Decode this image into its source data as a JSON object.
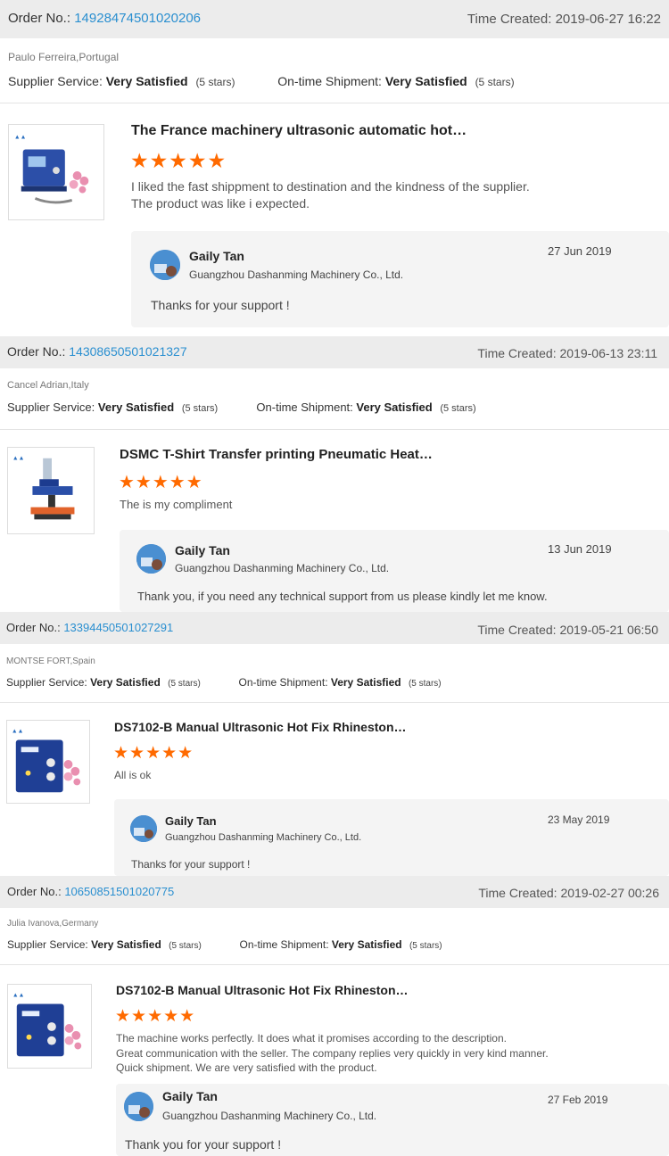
{
  "labels": {
    "order_no": "Order No.:",
    "time_created": "Time Created:",
    "supplier_service": "Supplier Service:",
    "ontime_shipment": "On-time Shipment:",
    "very_satisfied": "Very Satisfied",
    "five_stars": "(5 stars)",
    "stars_glyphs": "★★★★★"
  },
  "orders": [
    {
      "order_no": "14928474501020206",
      "time_created": "2019-06-27 16:22",
      "buyer": "Paulo Ferreira,Portugal",
      "product_title": "The France machinery ultrasonic automatic hot…",
      "rating": 5,
      "review": "I liked the fast shippment to destination and the kindness of the supplier.\nThe product was like i expected.",
      "reply": {
        "name": "Gaily Tan",
        "company": "Guangzhou Dashanming Machinery Co., Ltd.",
        "date": "27 Jun 2019",
        "text": "Thanks for your support !"
      }
    },
    {
      "order_no": "14308650501021327",
      "time_created": "2019-06-13 23:11",
      "buyer": "Cancel Adrian,Italy",
      "product_title": "DSMC T-Shirt Transfer printing Pneumatic Heat…",
      "rating": 5,
      "review": "The is my compliment",
      "reply": {
        "name": "Gaily Tan",
        "company": "Guangzhou Dashanming Machinery Co., Ltd.",
        "date": "13 Jun 2019",
        "text": "Thank you, if you need any technical support from us please kindly let me know."
      }
    },
    {
      "order_no": "13394450501027291",
      "time_created": "2019-05-21 06:50",
      "buyer": "MONTSE FORT,Spain",
      "product_title": "DS7102-B Manual Ultrasonic Hot Fix Rhineston…",
      "rating": 5,
      "review": "All is ok",
      "reply": {
        "name": "Gaily Tan",
        "company": "Guangzhou Dashanming Machinery Co., Ltd.",
        "date": "23 May 2019",
        "text": "Thanks for your support !"
      }
    },
    {
      "order_no": "10650851501020775",
      "time_created": "2019-02-27 00:26",
      "buyer": "Julia Ivanova,Germany",
      "product_title": "DS7102-B Manual Ultrasonic Hot Fix Rhineston…",
      "rating": 5,
      "review": "The machine works perfectly. It does what it promises according to the description.\nGreat communication with the seller. The company replies very quickly in very kind manner.\nQuick shipment. We are very satisfied with the product.",
      "reply": {
        "name": "Gaily Tan",
        "company": "Guangzhou Dashanming Machinery Co., Ltd.",
        "date": "27 Feb 2019",
        "text": "Thank you for your support !"
      }
    }
  ],
  "colors": {
    "link": "#2a8fd0",
    "star": "#ff6a00",
    "header_bg": "#ececec",
    "reply_bg": "#f4f4f4"
  }
}
